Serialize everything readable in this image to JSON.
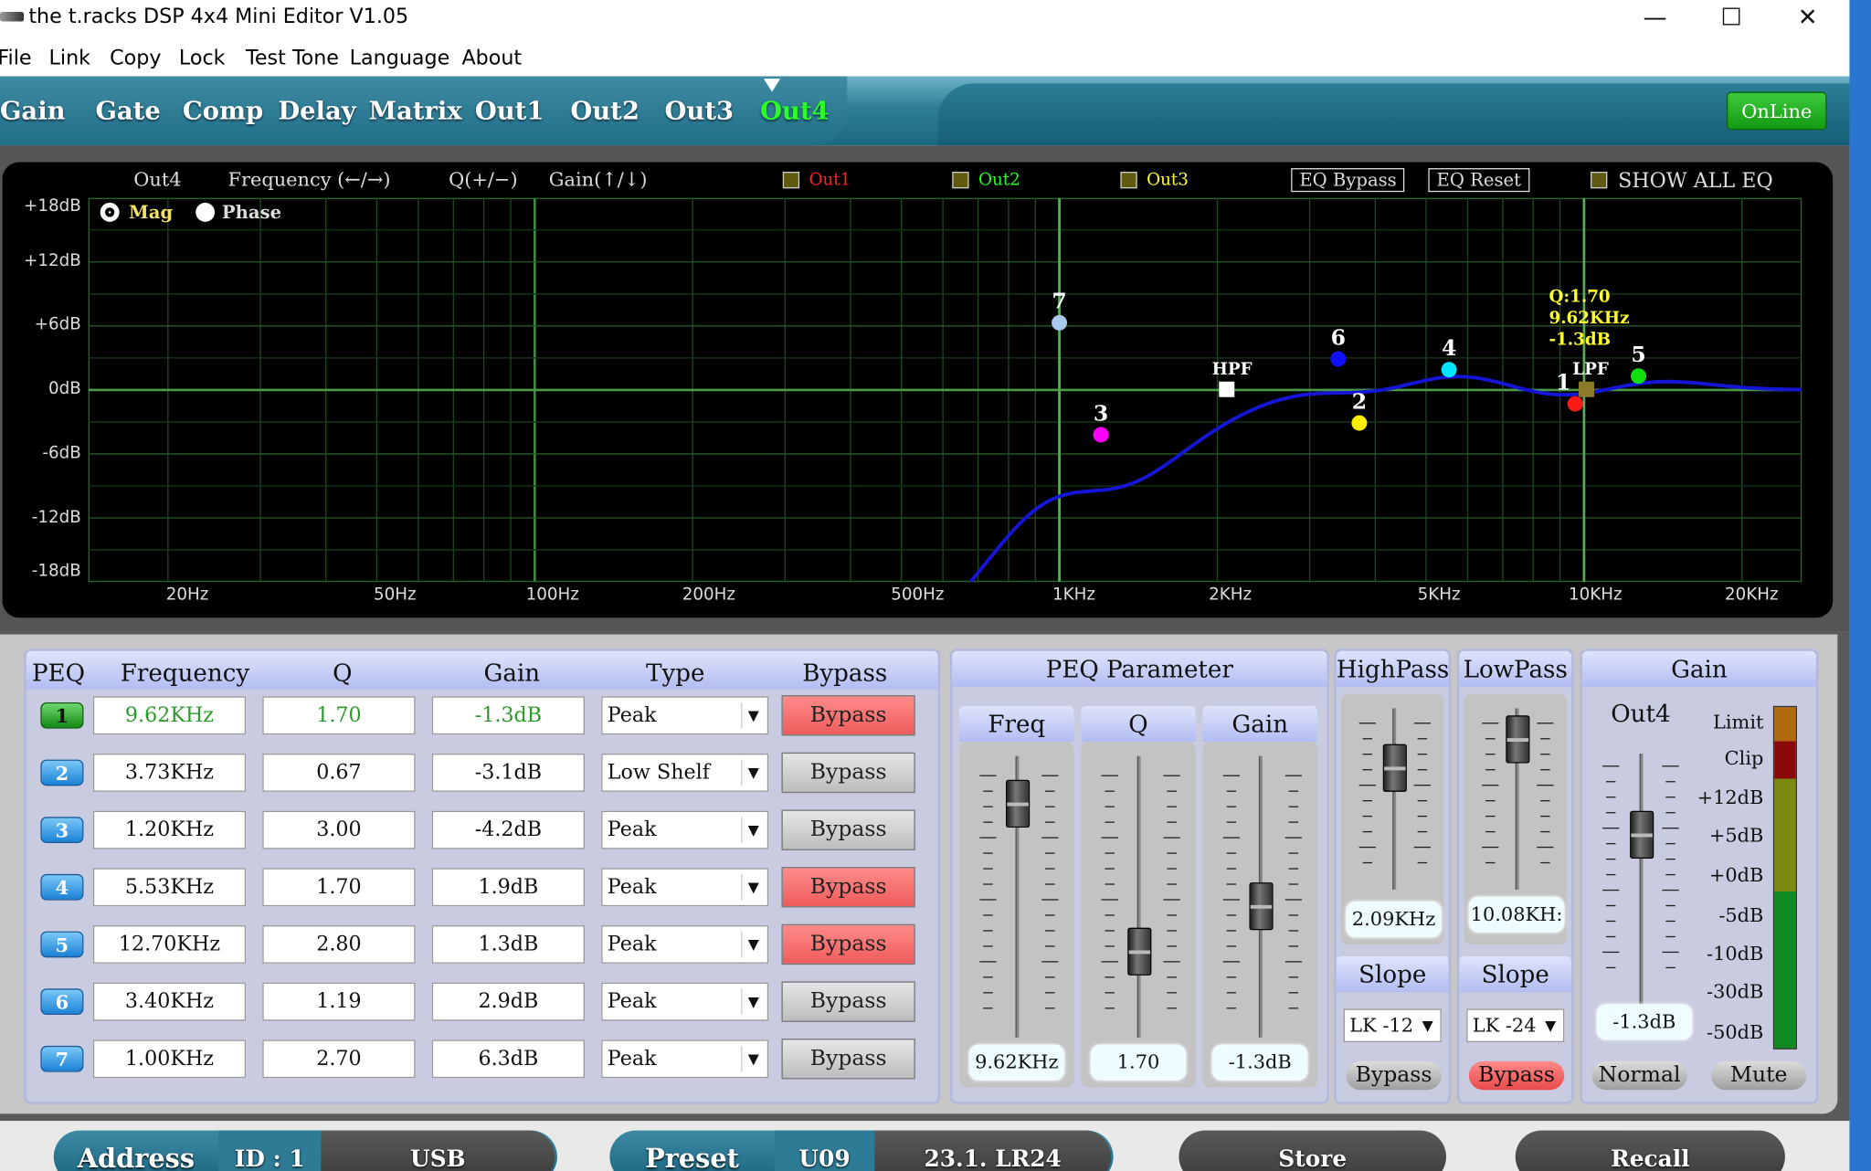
{
  "window": {
    "title": "the t.racks DSP 4x4 Mini Editor V1.05",
    "min": "—",
    "max": "☐",
    "close": "✕"
  },
  "menu": [
    "File",
    "Link",
    "Copy",
    "Lock",
    "Test Tone",
    "Language",
    "About"
  ],
  "tabs": [
    "Gain",
    "Gate",
    "Comp",
    "Delay",
    "Matrix",
    "Out1",
    "Out2",
    "Out3",
    "Out4"
  ],
  "active_tab": "Out4",
  "status": "OnLine",
  "graph": {
    "hdr_out": "Out4",
    "hdr_freq": "Frequency (←/→)",
    "hdr_q": "Q(+/−)",
    "hdr_gain": "Gain(↑/↓)",
    "overlay": [
      {
        "label": "Out1",
        "color": "#ff2020"
      },
      {
        "label": "Out2",
        "color": "#20ff20"
      },
      {
        "label": "Out3",
        "color": "#ffff30"
      }
    ],
    "eq_bypass": "EQ Bypass",
    "eq_reset": "EQ Reset",
    "show_all": "SHOW ALL EQ",
    "mag": "Mag",
    "phase": "Phase",
    "y_ticks": [
      "+18dB",
      "+12dB",
      "+6dB",
      "0dB",
      "-6dB",
      "-12dB",
      "-18dB"
    ],
    "x_ticks": [
      "20Hz",
      "50Hz",
      "100Hz",
      "200Hz",
      "500Hz",
      "1KHz",
      "2KHz",
      "5KHz",
      "10KHz",
      "20KHz"
    ],
    "markers": [
      {
        "label": "1",
        "freq_hz": 9620,
        "gain_db": -1.3,
        "color": "#ff1a1a"
      },
      {
        "label": "2",
        "freq_hz": 3730,
        "gain_db": -3.1,
        "color": "#ffee00"
      },
      {
        "label": "3",
        "freq_hz": 1200,
        "gain_db": -4.2,
        "color": "#ff00ff"
      },
      {
        "label": "4",
        "freq_hz": 5530,
        "gain_db": 1.9,
        "color": "#00e5ff"
      },
      {
        "label": "5",
        "freq_hz": 12700,
        "gain_db": 1.3,
        "color": "#10e010"
      },
      {
        "label": "6",
        "freq_hz": 3400,
        "gain_db": 2.9,
        "color": "#1010ff"
      },
      {
        "label": "7",
        "freq_hz": 1000,
        "gain_db": 6.3,
        "color": "#a8c8ec"
      }
    ],
    "hpf": {
      "label": "HPF",
      "freq_hz": 2090
    },
    "lpf": {
      "label": "LPF",
      "freq_hz": 10080
    },
    "readout": {
      "q": "Q:1.70",
      "freq": "9.62KHz",
      "gain": "-1.3dB"
    }
  },
  "peq": {
    "headers": [
      "PEQ",
      "Frequency",
      "Q",
      "Gain",
      "Type",
      "Bypass"
    ],
    "rows": [
      {
        "n": "1",
        "freq": "9.62KHz",
        "q": "1.70",
        "gain": "-1.3dB",
        "type": "Peak",
        "bypass": "Bypass",
        "bypass_on": true,
        "selected": true
      },
      {
        "n": "2",
        "freq": "3.73KHz",
        "q": "0.67",
        "gain": "-3.1dB",
        "type": "Low Shelf",
        "bypass": "Bypass",
        "bypass_on": false
      },
      {
        "n": "3",
        "freq": "1.20KHz",
        "q": "3.00",
        "gain": "-4.2dB",
        "type": "Peak",
        "bypass": "Bypass",
        "bypass_on": false
      },
      {
        "n": "4",
        "freq": "5.53KHz",
        "q": "1.70",
        "gain": "1.9dB",
        "type": "Peak",
        "bypass": "Bypass",
        "bypass_on": true
      },
      {
        "n": "5",
        "freq": "12.70KHz",
        "q": "2.80",
        "gain": "1.3dB",
        "type": "Peak",
        "bypass": "Bypass",
        "bypass_on": true
      },
      {
        "n": "6",
        "freq": "3.40KHz",
        "q": "1.19",
        "gain": "2.9dB",
        "type": "Peak",
        "bypass": "Bypass",
        "bypass_on": false
      },
      {
        "n": "7",
        "freq": "1.00KHz",
        "q": "2.70",
        "gain": "6.3dB",
        "type": "Peak",
        "bypass": "Bypass",
        "bypass_on": false
      }
    ]
  },
  "param": {
    "title": "PEQ Parameter",
    "freq_label": "Freq",
    "q_label": "Q",
    "gain_label": "Gain",
    "freq": "9.62KHz",
    "q": "1.70",
    "gain": "-1.3dB"
  },
  "highpass": {
    "title": "HighPass",
    "value": "2.09KHz",
    "slope_label": "Slope",
    "slope": "LK -12",
    "bypass": "Bypass"
  },
  "lowpass": {
    "title": "LowPass",
    "value": "10.08KH:",
    "slope_label": "Slope",
    "slope": "LK -24",
    "bypass": "Bypass"
  },
  "gain": {
    "title": "Gain",
    "channel": "Out4",
    "value": "-1.3dB",
    "normal": "Normal",
    "mute": "Mute",
    "meter_labels": [
      "Limit",
      "Clip",
      "+12dB",
      "+5dB",
      "+0dB",
      "-5dB",
      "-10dB",
      "-30dB",
      "-50dB"
    ]
  },
  "bottom": {
    "address": "Address",
    "id": "ID : 1",
    "usb": "USB",
    "preset": "Preset",
    "preset_num": "U09",
    "preset_name": "23.1. LR24",
    "store": "Store",
    "recall": "Recall"
  }
}
